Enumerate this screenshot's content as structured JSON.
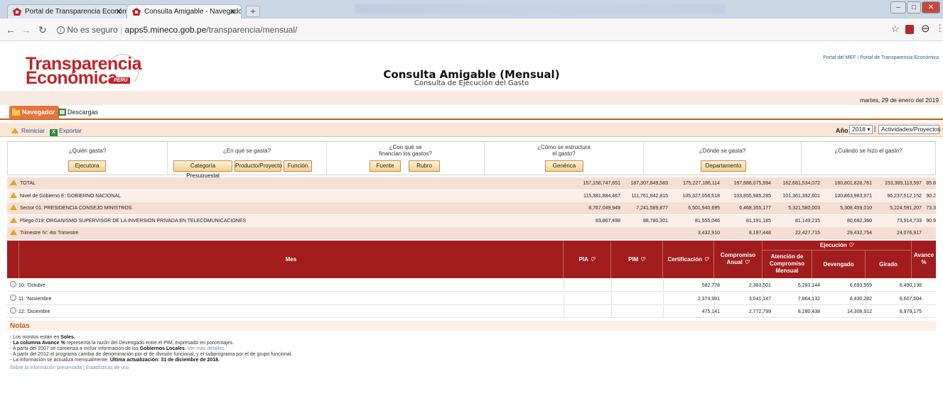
{
  "browser": {
    "tabs": [
      {
        "label": "Portal de Transparencia Económi"
      },
      {
        "label": "Consulta Amigable - Navegador"
      }
    ],
    "url_prefix": "No es seguro",
    "url_host": "apps5.mineco.gob.pe",
    "url_path": "/transparencia/mensual/"
  },
  "header": {
    "logo_line1": "Transparencia",
    "logo_line2": "Económica",
    "logo_badge": "PERÚ",
    "title": "Consulta Amigable (Mensual)",
    "subtitle": "Consulta de Ejecución del Gasto",
    "link_mef": "Portal del MEF",
    "link_portal": "Portal de Transparencia Económica",
    "date": "martes, 29 de enero del 2019"
  },
  "tabs": {
    "navegador": "Navegador",
    "descargas": "Descargas"
  },
  "toolbar": {
    "reiniciar": "Reiniciar",
    "exportar": "Exportar",
    "year_label": "Año",
    "year_value": "2018",
    "scope_value": "Actividades/Proyectos"
  },
  "questions": {
    "quien": "¿Quién gasta?",
    "quien_btn": "Ejecutora",
    "en_que": "¿En qué se gasta?",
    "en_que_btn1": "Categoría Presupuestal",
    "en_que_btn2": "Producto/Proyecto",
    "en_que_btn3": "Función",
    "con_que_1": "¿Con qué se",
    "con_que_2": "financian los gastos?",
    "con_que_btn1": "Fuente",
    "con_que_btn2": "Rubro",
    "como_1": "¿Cómo se estructura",
    "como_2": "el gasto?",
    "como_btn": "Genérica",
    "donde": "¿Dónde se gasta?",
    "donde_btn": "Departamento",
    "cuando": "¿Cuándo se hizo el gasto?"
  },
  "summary_rows": [
    {
      "label": "TOTAL",
      "pia": "157,158,747,651",
      "pim": "187,307,849,583",
      "cert": "175,227,186,114",
      "comp": "167,888,075,994",
      "aten": "162,681,534,072",
      "dev": "160,801,828,761",
      "gir": "153,389,113,597",
      "av": "85.8"
    },
    {
      "label": "Nivel de Gobierno E: GOBIERNO NACIONAL",
      "pia": "115,381,884,467",
      "pim": "111,761,842,815",
      "cert": "105,327,056,618",
      "comp": "103,855,985,285",
      "aten": "101,361,392,601",
      "dev": "100,863,983,971",
      "gir": "96,237,512,152",
      "av": "90.2"
    },
    {
      "label": "Sector 01: PRESIDENCIA CONSEJO MINISTROS",
      "pia": "8,767,049,949",
      "pim": "7,241,589,877",
      "cert": "6,501,940,695",
      "comp": "6,468,355,177",
      "aten": "5,321,580,003",
      "dev": "5,308,459,010",
      "gir": "5,224,591,207",
      "av": "73.3"
    },
    {
      "label": "Pliego 019: ORGANISMO SUPERVISOR DE LA INVERSION PRIVADA EN TELECOMUNICACIONES",
      "pia": "83,867,498",
      "pim": "88,780,301",
      "cert": "81,555,046",
      "comp": "81,191,185",
      "aten": "81,149,215",
      "dev": "80,682,360",
      "gir": "73,914,733",
      "av": "90.9"
    },
    {
      "label": "Trimestre IV: 4to Trimestre",
      "pia": "",
      "pim": "",
      "cert": "3,432,910",
      "comp": "8,197,448",
      "aten": "22,427,715",
      "dev": "29,432,754",
      "gir": "24,076,917",
      "av": ""
    }
  ],
  "table_headers": {
    "mes": "Mes",
    "pia": "PIA",
    "pim": "PIM",
    "cert": "Certificación",
    "comp_1": "Compromiso",
    "comp_2": "Anual",
    "ejec": "Ejecución",
    "aten_1": "Atención de",
    "aten_2": "Compromiso",
    "aten_3": "Mensual",
    "dev": "Devengado",
    "gir": "Girado",
    "av_1": "Avance",
    "av_2": "%"
  },
  "month_rows": [
    {
      "mes": "10: 'Octubre",
      "pia": "",
      "pim": "",
      "cert": "582,778",
      "comp": "2,383,501",
      "aten": "6,283,144",
      "dev": "6,693,559",
      "gir": "6,490,138",
      "av": ""
    },
    {
      "mes": "11: 'Noviembre",
      "pia": "",
      "pim": "",
      "cert": "2,374,991",
      "comp": "3,041,147",
      "aten": "7,864,132",
      "dev": "8,430,282",
      "gir": "8,607,604",
      "av": ""
    },
    {
      "mes": "12: 'Diciembre",
      "pia": "",
      "pim": "",
      "cert": "475,141",
      "comp": "2,772,799",
      "aten": "8,280,438",
      "dev": "14,308,912",
      "gir": "8,979,175",
      "av": ""
    }
  ],
  "notes": {
    "title": "Notas",
    "n1_a": "- Los montos están en ",
    "n1_b": "Soles.",
    "n2_a": "La columna Avance %",
    "n2_b": " representa la razón del Devengado entre el PIM, expresado en porcentajes.",
    "n3_a": "- A partir del 2007 se comienza a incluir información de los ",
    "n3_b": "Gobiernos Locales",
    "n3_c": ". ",
    "n3_link": "Ver más detalles.",
    "n4": "- A partir del 2012 el programa cambia de denominación por el de división funcional, y el subprograma por el de grupo funcional.",
    "n5_a": "- La información se actualiza mensualmente. ",
    "n5_b": "Última actualización: 31 de diciembre de 2018.",
    "footer_1": "Sobre la información presentada",
    "footer_2": "Estadísticas de uso"
  }
}
